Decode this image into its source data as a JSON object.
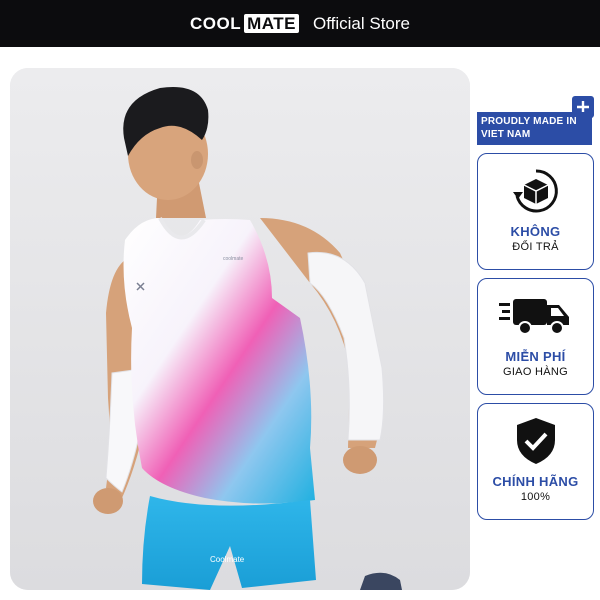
{
  "header": {
    "brand_cool": "COOL",
    "brand_mate": "MATE",
    "store_label": "Official Store"
  },
  "badge": {
    "made_in": "PROUDLY MADE IN VIET NAM"
  },
  "features": [
    {
      "title": "KHÔNG",
      "subtitle": "ĐỔI TRẢ",
      "icon": "return-box-icon"
    },
    {
      "title": "MIỄN PHÍ",
      "subtitle": "GIAO HÀNG",
      "icon": "delivery-truck-icon"
    },
    {
      "title": "CHÍNH HÃNG",
      "subtitle": "100%",
      "icon": "shield-check-icon"
    }
  ],
  "product_photo": {
    "description_icon": "model-photo",
    "shorts_text": "Coolmate"
  },
  "colors": {
    "accent": "#2c4da6",
    "header_bg": "#0c0c0e"
  }
}
